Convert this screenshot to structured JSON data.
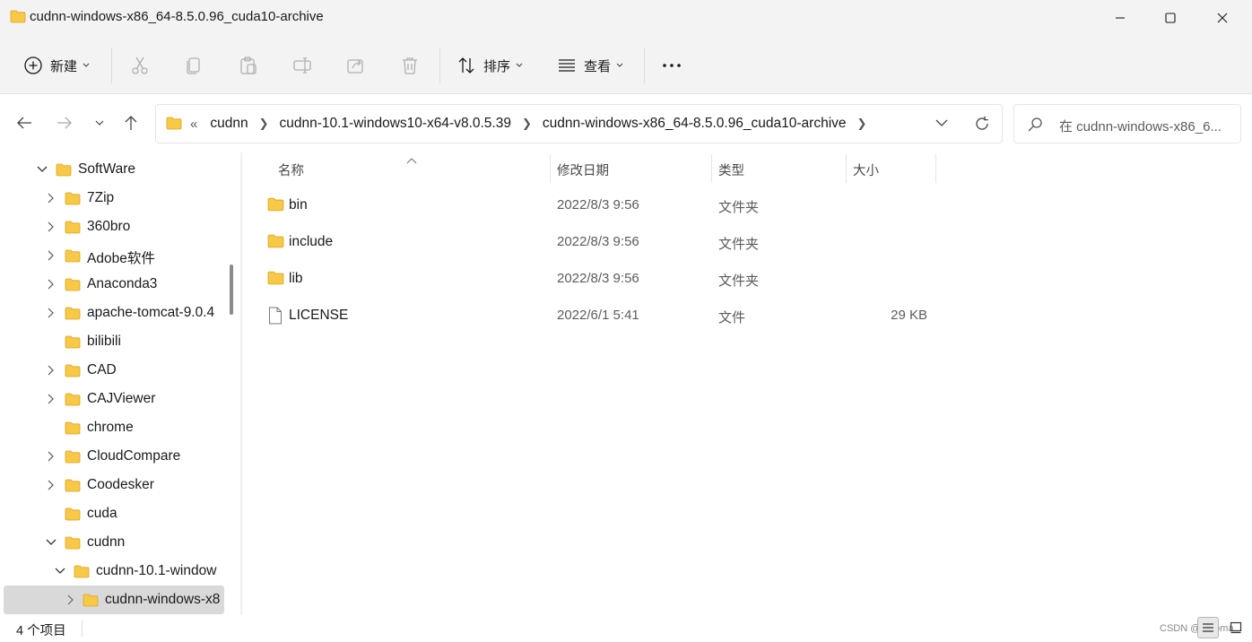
{
  "window": {
    "title": "cudnn-windows-x86_64-8.5.0.96_cuda10-archive"
  },
  "toolbar": {
    "new_label": "新建",
    "sort_label": "排序",
    "view_label": "查看",
    "more_label": "···"
  },
  "address": {
    "overflow": "«",
    "crumbs": [
      "cudnn",
      "cudnn-10.1-windows10-x64-v8.0.5.39",
      "cudnn-windows-x86_64-8.5.0.96_cuda10-archive"
    ]
  },
  "search": {
    "placeholder": "在 cudnn-windows-x86_6..."
  },
  "tree": {
    "items": [
      {
        "label": "SoftWare",
        "expanded": true
      },
      {
        "label": "7Zip"
      },
      {
        "label": "360bro"
      },
      {
        "label": "Adobe软件"
      },
      {
        "label": "Anaconda3"
      },
      {
        "label": "apache-tomcat-9.0.4"
      },
      {
        "label": "bilibili"
      },
      {
        "label": "CAD"
      },
      {
        "label": "CAJViewer"
      },
      {
        "label": "chrome"
      },
      {
        "label": "CloudCompare"
      },
      {
        "label": "Coodesker"
      },
      {
        "label": "cuda"
      },
      {
        "label": "cudnn",
        "expanded": true
      },
      {
        "label": "cudnn-10.1-window",
        "expanded": true
      },
      {
        "label": "cudnn-windows-x8",
        "selected": true
      }
    ]
  },
  "columns": {
    "name": "名称",
    "date": "修改日期",
    "type": "类型",
    "size": "大小"
  },
  "files": [
    {
      "name": "bin",
      "date": "2022/8/3 9:56",
      "type": "文件夹",
      "size": "",
      "icon": "folder-icon"
    },
    {
      "name": "include",
      "date": "2022/8/3 9:56",
      "type": "文件夹",
      "size": "",
      "icon": "folder-icon"
    },
    {
      "name": "lib",
      "date": "2022/8/3 9:56",
      "type": "文件夹",
      "size": "",
      "icon": "folder-icon"
    },
    {
      "name": "LICENSE",
      "date": "2022/6/1 5:41",
      "type": "文件",
      "size": "29 KB",
      "icon": "file-icon"
    }
  ],
  "status": {
    "count": "4 个项目",
    "watermark": "CSDN @Wyoma"
  },
  "colors": {
    "folder": "#f8c946",
    "selection": "#d9d9d9",
    "chrome": "#f3f3f3"
  }
}
